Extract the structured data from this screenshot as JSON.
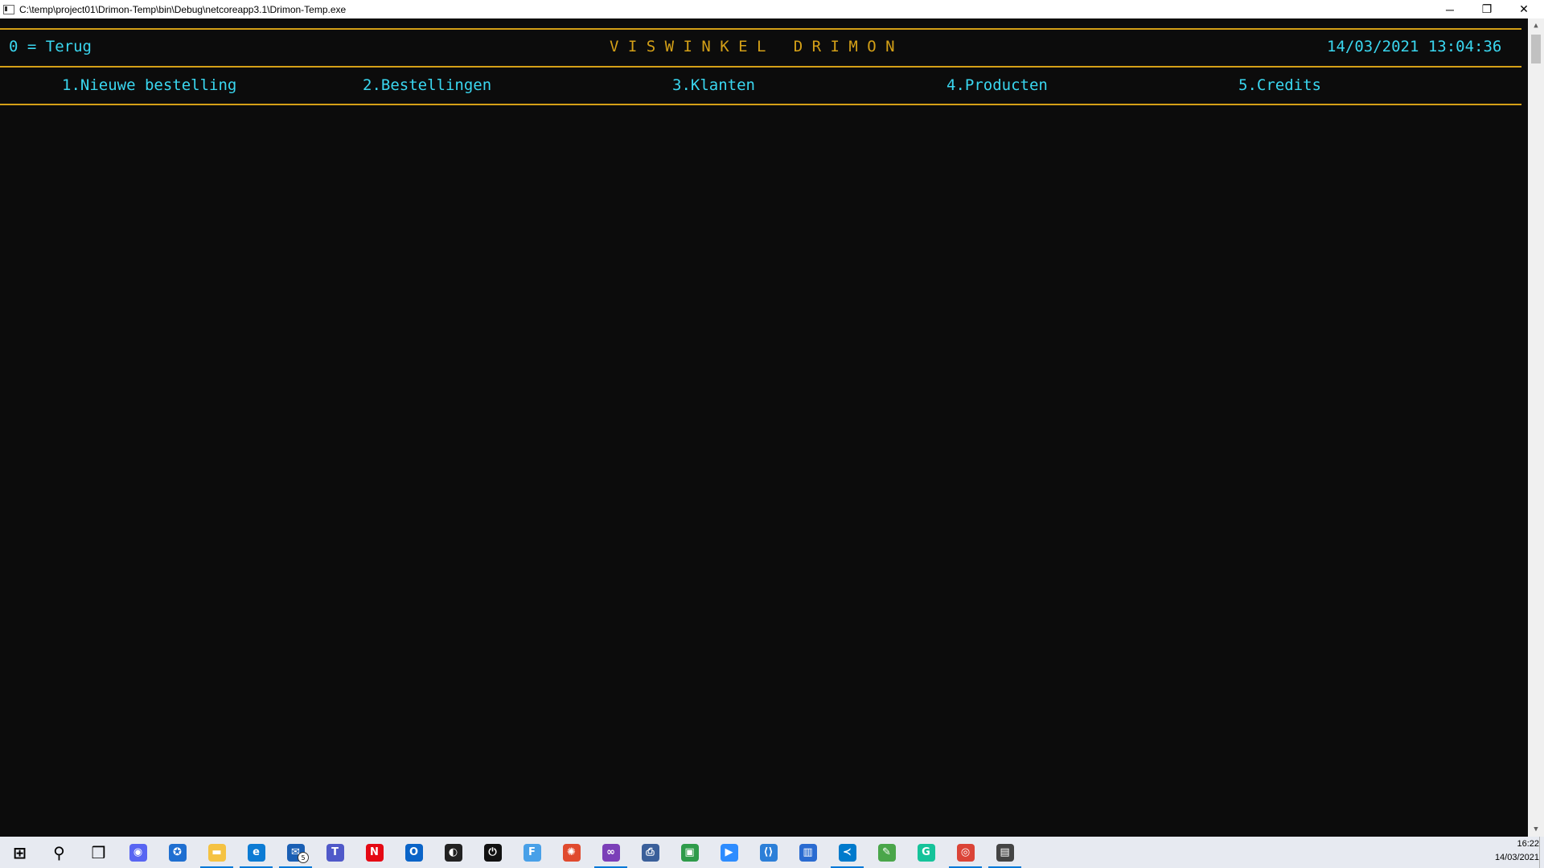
{
  "window": {
    "title": "C:\\temp\\project01\\Drimon-Temp\\bin\\Debug\\netcoreapp3.1\\Drimon-Temp.exe",
    "minimize": "─",
    "restore": "❐",
    "close": "✕"
  },
  "console": {
    "back": "0 = Terug",
    "app_title": "V I S W I N K E L   D R I M O N",
    "datetime": "14/03/2021 13:04:36",
    "menu": [
      {
        "label": "1.Nieuwe bestelling"
      },
      {
        "label": "2.Bestellingen"
      },
      {
        "label": "3.Klanten"
      },
      {
        "label": "4.Producten"
      },
      {
        "label": "5.Credits"
      }
    ],
    "colors": {
      "text": "#3ad7f0",
      "accent": "#d4a017",
      "background": "#0c0c0c"
    }
  },
  "taskbar": {
    "items": [
      {
        "name": "start",
        "glyph": "⊞",
        "color": "#000000"
      },
      {
        "name": "search",
        "glyph": "⚲",
        "color": "#000000"
      },
      {
        "name": "task-view",
        "glyph": "❒",
        "color": "#000000"
      },
      {
        "name": "discord",
        "glyph": "◉",
        "color": "#5865f2"
      },
      {
        "name": "app-blue",
        "glyph": "✪",
        "color": "#1f6fd1"
      },
      {
        "name": "file-explorer",
        "glyph": "▬",
        "color": "#f5c242"
      },
      {
        "name": "edge",
        "glyph": "e",
        "color": "#0c7bd4"
      },
      {
        "name": "mail",
        "glyph": "✉",
        "color": "#1a5fb4",
        "badge": "5"
      },
      {
        "name": "teams",
        "glyph": "T",
        "color": "#5059c9"
      },
      {
        "name": "netflix",
        "glyph": "N",
        "color": "#e50914"
      },
      {
        "name": "outlook",
        "glyph": "O",
        "color": "#0a64c8"
      },
      {
        "name": "app-github",
        "glyph": "◐",
        "color": "#222222"
      },
      {
        "name": "app-power",
        "glyph": "⏻",
        "color": "#111111"
      },
      {
        "name": "app-f",
        "glyph": "F",
        "color": "#48a0e8"
      },
      {
        "name": "app-swirl",
        "glyph": "✺",
        "color": "#e04a2e"
      },
      {
        "name": "visual-studio",
        "glyph": "∞",
        "color": "#7b3fb8"
      },
      {
        "name": "app-printer",
        "glyph": "⎙",
        "color": "#3a5f9a"
      },
      {
        "name": "app-green",
        "glyph": "▣",
        "color": "#2e9b4a"
      },
      {
        "name": "zoom",
        "glyph": "▶",
        "color": "#2d8cff"
      },
      {
        "name": "app-code",
        "glyph": "⟨⟩",
        "color": "#2c7fd8"
      },
      {
        "name": "app-window",
        "glyph": "▥",
        "color": "#2a6bd1"
      },
      {
        "name": "vscode",
        "glyph": "≺",
        "color": "#007acc"
      },
      {
        "name": "notepad",
        "glyph": "✎",
        "color": "#4aa64a"
      },
      {
        "name": "grammarly",
        "glyph": "G",
        "color": "#15c39a"
      },
      {
        "name": "chrome",
        "glyph": "◎",
        "color": "#db4437"
      },
      {
        "name": "console-app",
        "glyph": "▤",
        "color": "#444444"
      }
    ],
    "clock_time": "16:22",
    "clock_date": "14/03/2021"
  }
}
